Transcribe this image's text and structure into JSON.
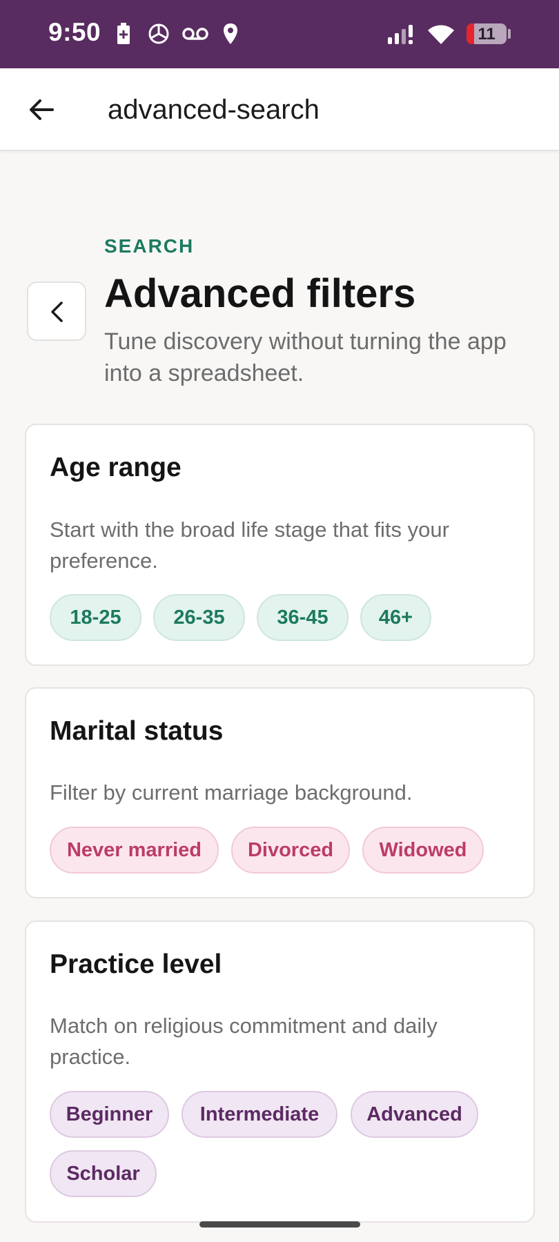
{
  "status_bar": {
    "time": "9:50",
    "battery_level": "11",
    "background_color": "#582c60",
    "icons_left": [
      "battery-saver-icon",
      "chatgpt-icon",
      "voicemail-icon",
      "location-icon"
    ],
    "icons_right": [
      "signal-icon",
      "wifi-icon",
      "battery-icon"
    ]
  },
  "app_bar": {
    "title": "advanced-search",
    "back_icon": "arrow-left-icon"
  },
  "header": {
    "eyebrow": "SEARCH",
    "title": "Advanced filters",
    "subtitle": "Tune discovery without turning the app into a spreadsheet.",
    "back_icon": "chevron-left-icon"
  },
  "sections": [
    {
      "title": "Age range",
      "description": "Start with the broad life stage that fits your preference.",
      "chips": [
        "18-25",
        "26-35",
        "36-45",
        "46+"
      ],
      "accent": "#1d7a5f"
    },
    {
      "title": "Marital status",
      "description": "Filter by current marriage background.",
      "chips": [
        "Never married",
        "Divorced",
        "Widowed"
      ],
      "accent": "#bc3c67"
    },
    {
      "title": "Practice level",
      "description": "Match on religious commitment and daily practice.",
      "chips": [
        "Beginner",
        "Intermediate",
        "Advanced",
        "Scholar"
      ],
      "accent": "#5b2a63"
    }
  ]
}
